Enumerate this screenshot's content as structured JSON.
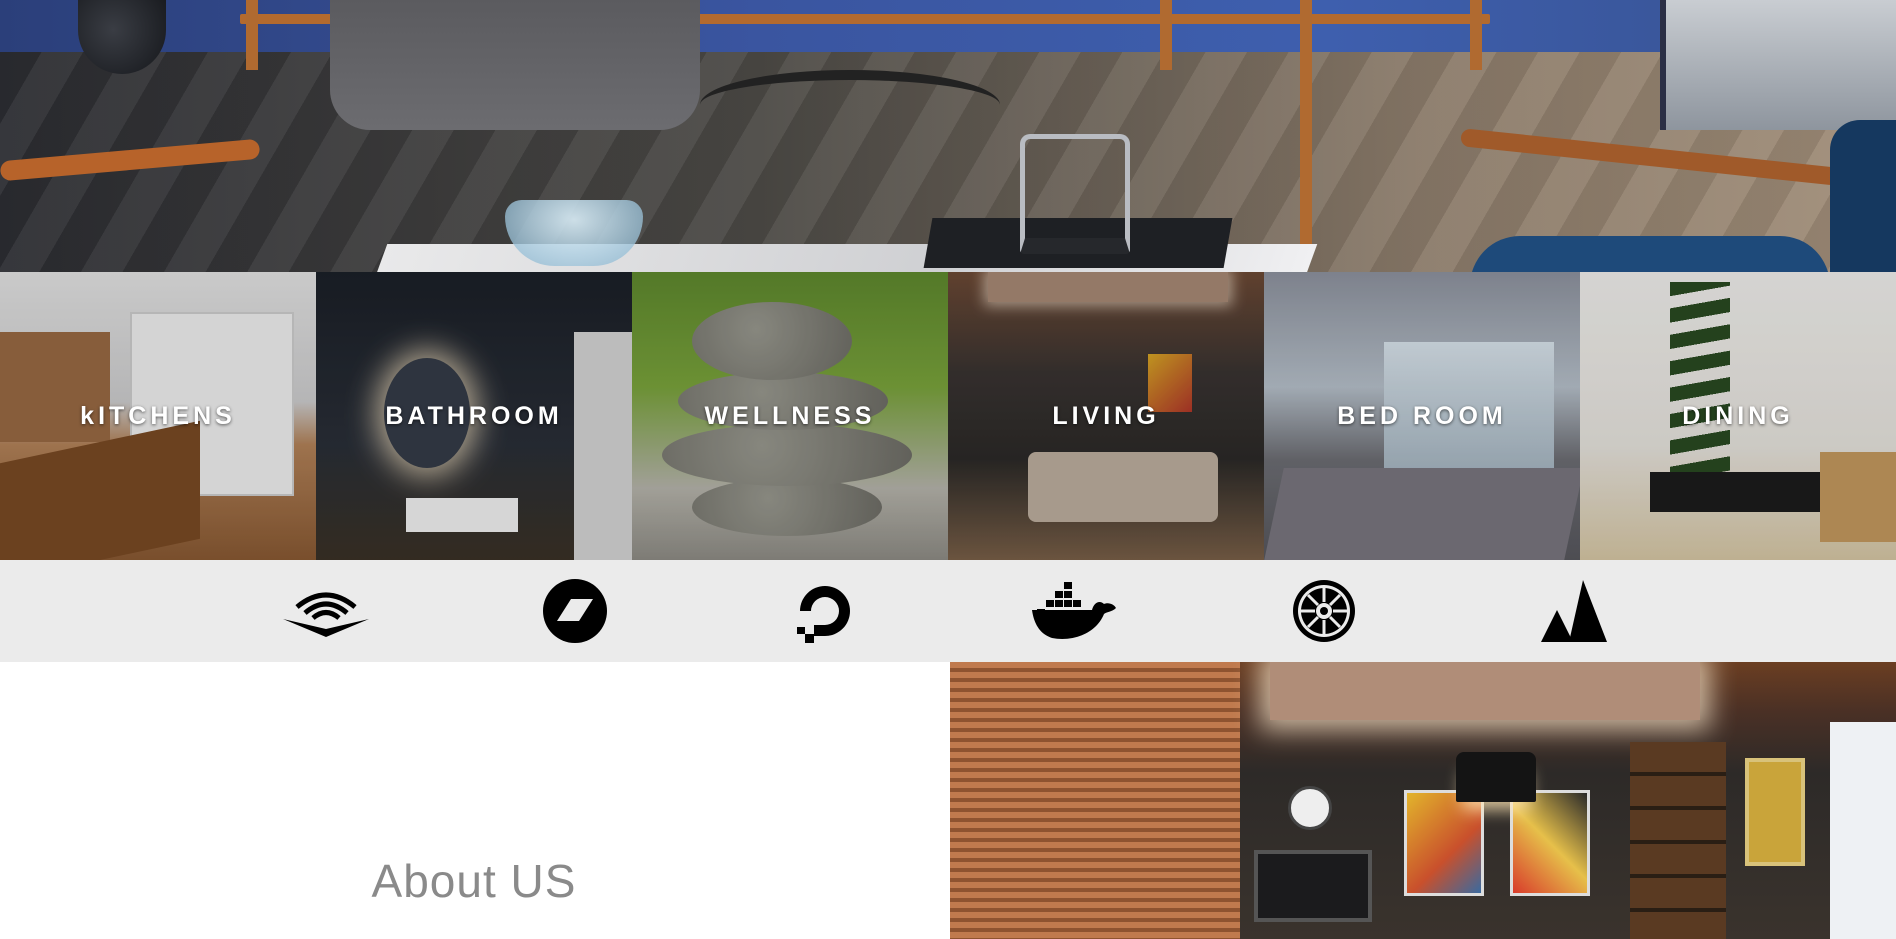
{
  "categories": [
    {
      "label": "kITCHENS"
    },
    {
      "label": "BATHROOM"
    },
    {
      "label": "WELLNESS"
    },
    {
      "label": "LIVING"
    },
    {
      "label": "BED ROOM"
    },
    {
      "label": "DINING"
    }
  ],
  "partner_logos": [
    {
      "icon": "audible-icon"
    },
    {
      "icon": "bandcamp-icon"
    },
    {
      "icon": "digitalocean-icon"
    },
    {
      "icon": "docker-icon"
    },
    {
      "icon": "galactic-empire-icon"
    },
    {
      "icon": "atlassian-icon"
    }
  ],
  "about": {
    "title": "About US"
  },
  "colors": {
    "logo_strip_bg": "#ebebeb",
    "about_title": "#8a8a8a",
    "tile_label": "#ffffff"
  }
}
